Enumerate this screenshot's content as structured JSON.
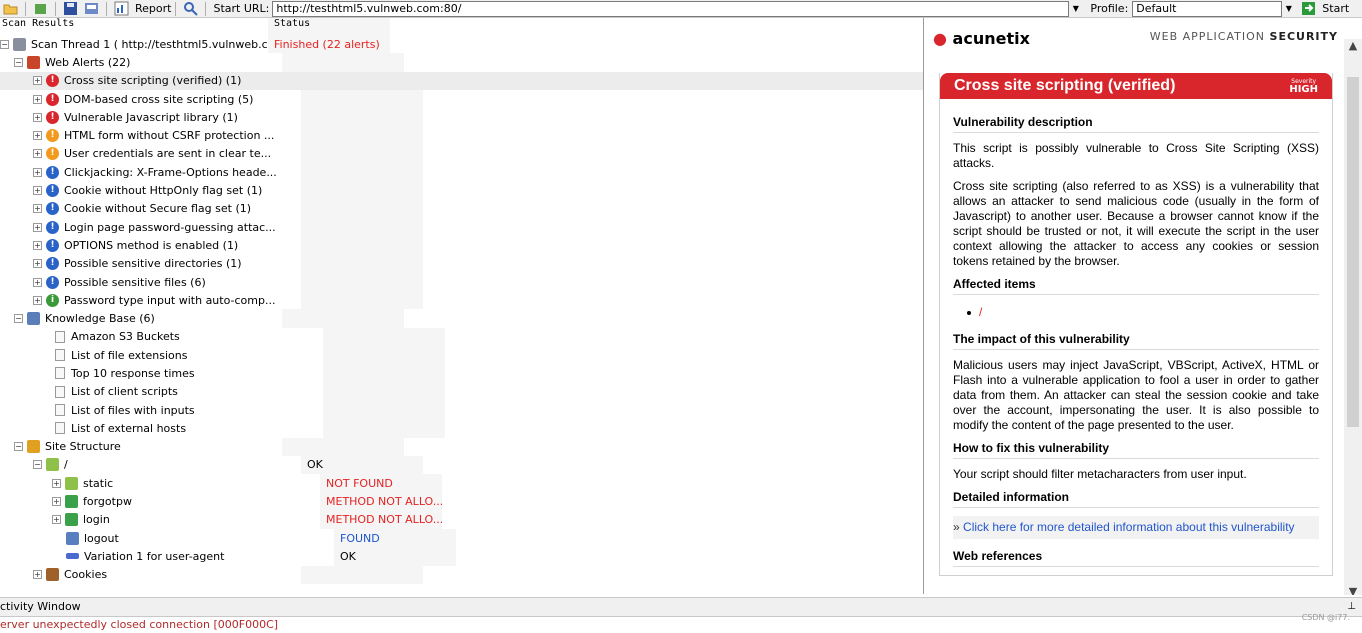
{
  "toolbar": {
    "report_label": "Report",
    "start_url_label": "Start URL:",
    "start_url_value": "http://testhtml5.vulnweb.com:80/",
    "profile_label": "Profile:",
    "profile_value": "Default",
    "start_label": "Start"
  },
  "tree": {
    "header_name": "Scan Results",
    "header_status": "Status",
    "rows": [
      {
        "name": "Scan Thread 1 ( http://testhtml5.vulnweb.c...",
        "status": "Finished (22 alerts)"
      },
      {
        "name": "Web Alerts (22)",
        "status": ""
      },
      {
        "name": "Cross site scripting (verified) (1)",
        "status": ""
      },
      {
        "name": "DOM-based cross site scripting (5)",
        "status": ""
      },
      {
        "name": "Vulnerable Javascript library (1)",
        "status": ""
      },
      {
        "name": "HTML form without CSRF protection ...",
        "status": ""
      },
      {
        "name": "User credentials are sent in clear te...",
        "status": ""
      },
      {
        "name": "Clickjacking: X-Frame-Options heade...",
        "status": ""
      },
      {
        "name": "Cookie without HttpOnly flag set (1)",
        "status": ""
      },
      {
        "name": "Cookie without Secure flag set (1)",
        "status": ""
      },
      {
        "name": "Login page password-guessing attac...",
        "status": ""
      },
      {
        "name": "OPTIONS method is enabled (1)",
        "status": ""
      },
      {
        "name": "Possible sensitive directories (1)",
        "status": ""
      },
      {
        "name": "Possible sensitive files (6)",
        "status": ""
      },
      {
        "name": "Password type input with auto-comp...",
        "status": ""
      },
      {
        "name": "Knowledge Base (6)",
        "status": ""
      },
      {
        "name": "Amazon S3 Buckets",
        "status": ""
      },
      {
        "name": "List of file extensions",
        "status": ""
      },
      {
        "name": "Top 10 response times",
        "status": ""
      },
      {
        "name": "List of client scripts",
        "status": ""
      },
      {
        "name": "List of files with inputs",
        "status": ""
      },
      {
        "name": "List of external hosts",
        "status": ""
      },
      {
        "name": "Site Structure",
        "status": ""
      },
      {
        "name": "/",
        "status": "OK"
      },
      {
        "name": "static",
        "status": "NOT FOUND"
      },
      {
        "name": "forgotpw",
        "status": "METHOD NOT ALLO..."
      },
      {
        "name": "login",
        "status": "METHOD NOT ALLO..."
      },
      {
        "name": "logout",
        "status": "FOUND"
      },
      {
        "name": "Variation 1 for user-agent",
        "status": "OK"
      },
      {
        "name": "Cookies",
        "status": ""
      }
    ]
  },
  "details": {
    "logo": "acunetix",
    "tagline_a": "WEB APPLICATION",
    "tagline_b": "SECURITY",
    "title": "Cross site scripting (verified)",
    "severity_label": "Severity",
    "severity_value": "HIGH",
    "desc_h": "Vulnerability description",
    "desc_p1": "This script is possibly vulnerable to Cross Site Scripting (XSS) attacks.",
    "desc_p2": "Cross site scripting (also referred to as XSS) is a vulnerability that allows an attacker to send malicious code (usually in the form of Javascript) to another user. Because a browser cannot know if the script should be trusted or not, it will execute the script in the user context allowing the attacker to access any cookies or session tokens retained by the browser.",
    "affected_h": "Affected items",
    "affected_item": "/",
    "impact_h": "The impact of this vulnerability",
    "impact_p": "Malicious users may inject JavaScript, VBScript, ActiveX, HTML or Flash into a vulnerable application to fool a user in order to gather data from them. An attacker can steal the session cookie and take over the account, impersonating the user. It is also possible to modify the content of the page presented to the user.",
    "fix_h": "How to fix this vulnerability",
    "fix_p": "Your script should filter metacharacters from user input.",
    "detail_h": "Detailed information",
    "detail_link": "Click here for more detailed information about this vulnerability",
    "webref_h": "Web references"
  },
  "activity": {
    "title": "ctivity Window",
    "message": "erver unexpectedly closed connection [000F000C]"
  },
  "watermark": "CSDN @i77."
}
